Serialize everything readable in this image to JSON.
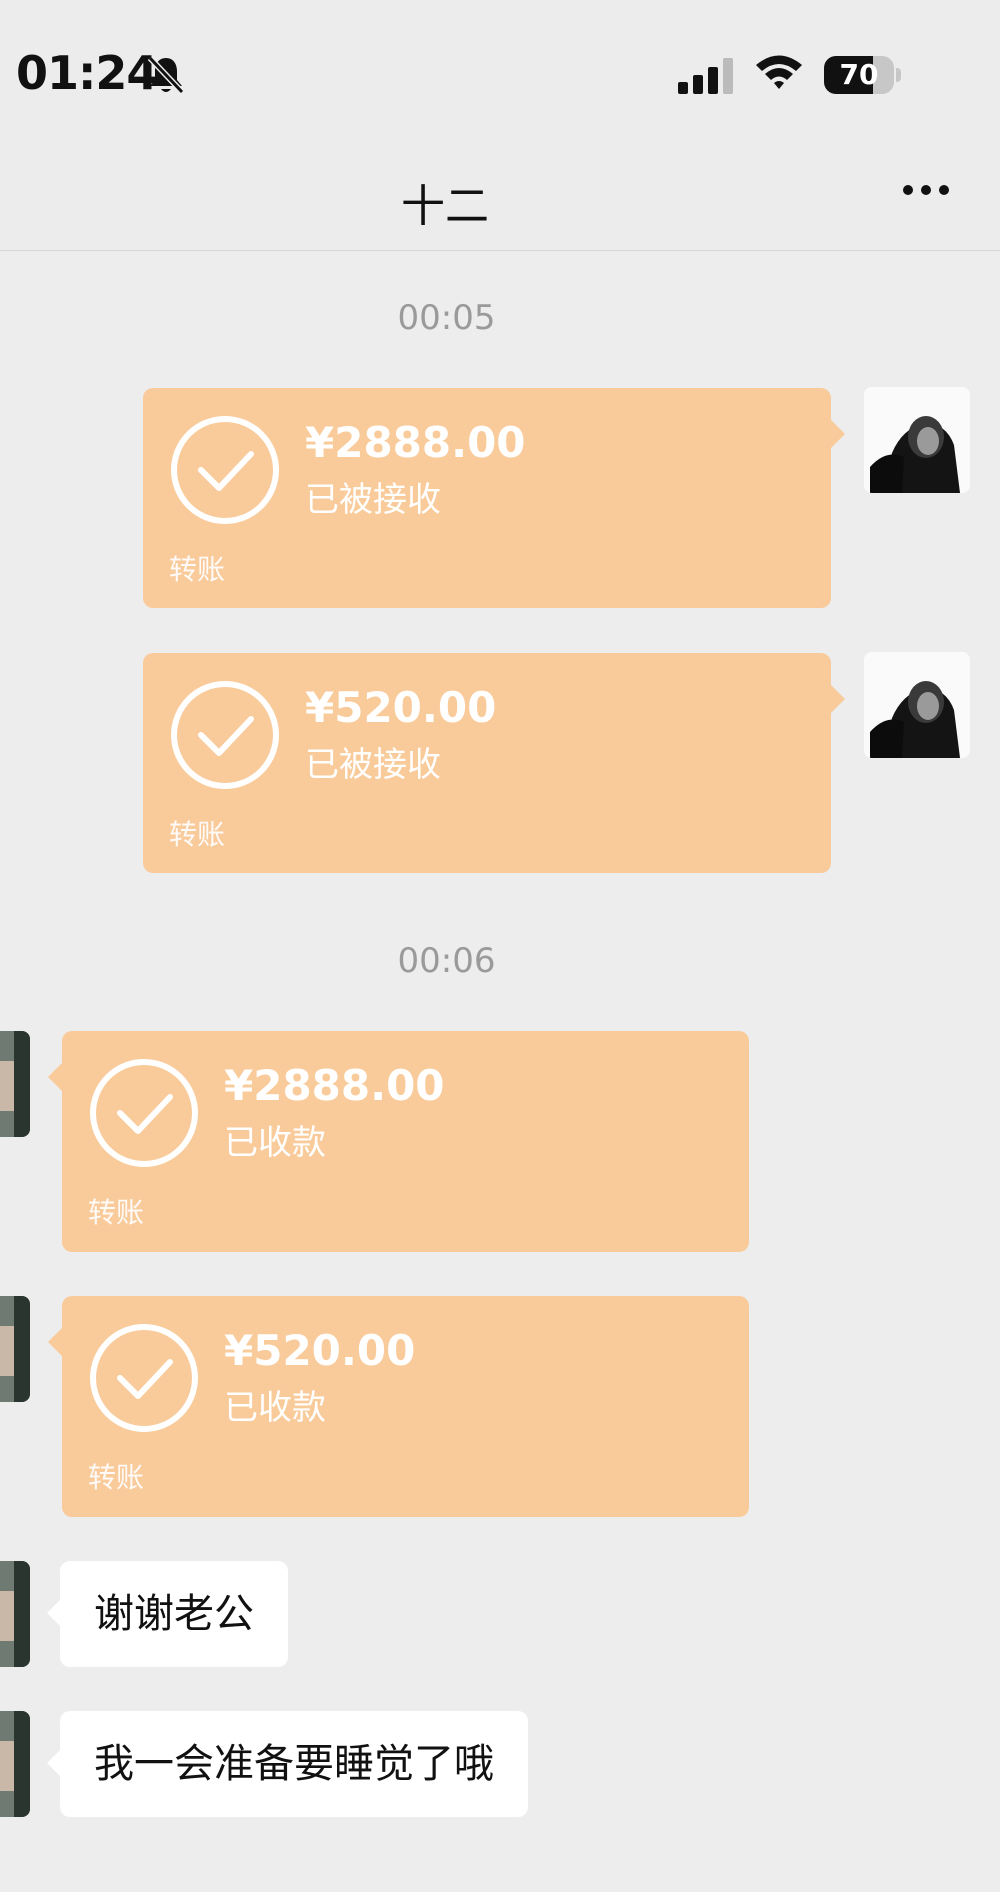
{
  "status_bar": {
    "time": "01:24",
    "battery": "70",
    "battery_level": 0.7
  },
  "header": {
    "title": "十二"
  },
  "messages": {
    "timestamp_1": "00:05",
    "timestamp_2": "00:06",
    "transfers": [
      {
        "amount": "¥2888.00",
        "status": "已被接收",
        "label": "转账"
      },
      {
        "amount": "¥520.00",
        "status": "已被接收",
        "label": "转账"
      },
      {
        "amount": "¥2888.00",
        "status": "已收款",
        "label": "转账"
      },
      {
        "amount": "¥520.00",
        "status": "已收款",
        "label": "转账"
      }
    ],
    "texts": [
      "谢谢老公",
      "我一会准备要睡觉了哦"
    ]
  },
  "icons": {
    "status": [
      "bell-slash-icon",
      "signal-icon",
      "wifi-icon",
      "battery-icon"
    ],
    "nav": [
      "more-icon"
    ],
    "card": "checkmark-circle-icon"
  },
  "colors": {
    "transfer_card": "#f9cb9b",
    "background": "#ededed",
    "bubble": "#ffffff"
  }
}
